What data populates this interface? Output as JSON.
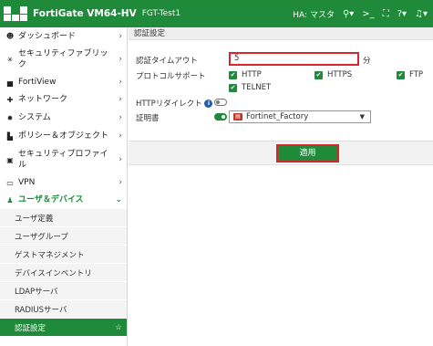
{
  "topbar": {
    "product": "FortiGate VM64-HV",
    "hostname": "FGT-Test1",
    "ha_status": "HA: マスタ",
    "search_icon": "search-icon",
    "cli_icon": "terminal-icon",
    "fullscreen_icon": "fullscreen-icon",
    "help_icon": "help-icon",
    "alert_icon": "bell-icon"
  },
  "sidebar": {
    "items": [
      {
        "label": "ダッシュボード",
        "icon": "dashboard-icon"
      },
      {
        "label": "セキュリティファブリック",
        "icon": "fabric-icon"
      },
      {
        "label": "FortiView",
        "icon": "fortiview-icon"
      },
      {
        "label": "ネットワーク",
        "icon": "network-icon"
      },
      {
        "label": "システム",
        "icon": "gear-icon"
      },
      {
        "label": "ポリシー＆オブジェクト",
        "icon": "policy-icon"
      },
      {
        "label": "セキュリティプロファイル",
        "icon": "lock-icon"
      },
      {
        "label": "VPN",
        "icon": "vpn-icon"
      },
      {
        "label": "ユーザ＆デバイス",
        "icon": "user-icon"
      }
    ],
    "subitems": [
      {
        "label": "ユーザ定義"
      },
      {
        "label": "ユーザグループ"
      },
      {
        "label": "ゲストマネジメント"
      },
      {
        "label": "デバイスインベントリ"
      },
      {
        "label": "LDAPサーバ"
      },
      {
        "label": "RADIUSサーバ"
      },
      {
        "label": "認証設定"
      }
    ]
  },
  "main": {
    "breadcrumb": "認証設定",
    "timeout": {
      "label": "認証タイムアウト",
      "value": "5",
      "unit": "分"
    },
    "protocol": {
      "label": "プロトコルサポート",
      "options": [
        "HTTP",
        "HTTPS",
        "FTP",
        "TELNET"
      ]
    },
    "http_redirect": {
      "label": "HTTPリダイレクト"
    },
    "certificate": {
      "label": "証明書",
      "value": "Fortinet_Factory"
    },
    "apply_label": "適用"
  },
  "colors": {
    "accent": "#1f8a3a",
    "highlight": "#d6262e"
  }
}
